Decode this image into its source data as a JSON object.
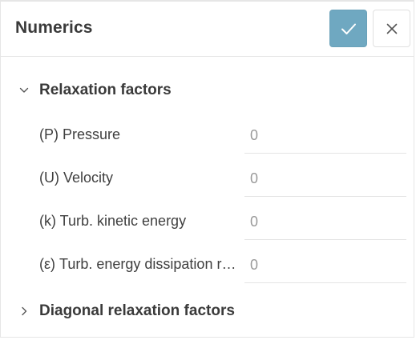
{
  "dialog": {
    "title": "Numerics",
    "confirm_icon": "check-icon",
    "close_icon": "close-icon",
    "colors": {
      "confirm_bg": "#6fa8c1",
      "border": "#e6e6e6"
    }
  },
  "sections": [
    {
      "label": "Relaxation factors",
      "expanded": true,
      "fields": [
        {
          "label": "(P) Pressure",
          "value": "0"
        },
        {
          "label": "(U) Velocity",
          "value": "0"
        },
        {
          "label": "(k) Turb. kinetic energy",
          "value": "0"
        },
        {
          "label": "(ε) Turb. energy dissipation rate",
          "value": "0"
        }
      ]
    },
    {
      "label": "Diagonal relaxation factors",
      "expanded": false
    }
  ]
}
